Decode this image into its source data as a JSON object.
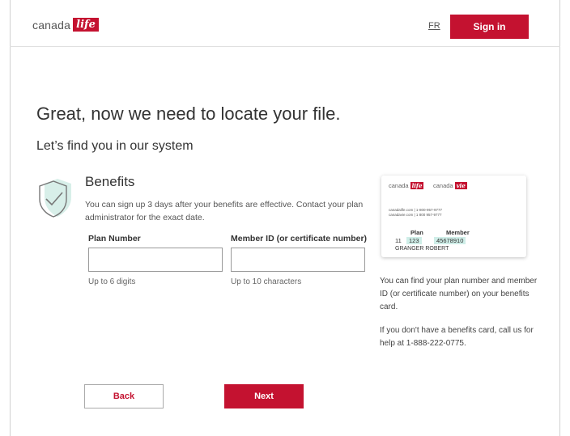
{
  "header": {
    "logo_word": "canada",
    "logo_box": "life",
    "lang_link": "FR",
    "signin_label": "Sign in"
  },
  "main": {
    "title": "Great, now we need to locate your file.",
    "subtitle": "Let’s find you in our system",
    "section_title": "Benefits",
    "section_desc": "You can sign up 3 days after your benefits are effective. Contact your plan administrator for the exact date.",
    "plan_label": "Plan Number",
    "plan_value": "",
    "plan_hint": "Up to 6 digits",
    "member_label": "Member ID (or certificate number)",
    "member_value": "",
    "member_hint": "Up to 10 characters"
  },
  "card": {
    "brand1_word": "canada",
    "brand1_box": "life",
    "brand2_word": "canada",
    "brand2_box": "vie",
    "line1": "canadalife.com | 1-800-957-9777",
    "line2": "canadavie.com | 1 800 957-9777",
    "plan_head": "Plan",
    "member_head": "Member",
    "plan_prefix": "11",
    "plan_number": "123",
    "member_number": "45678910",
    "member_name": "GRANGER ROBERT"
  },
  "help": {
    "find_text": "You can find your plan number and member ID (or certificate number) on your benefits card.",
    "call_text": "If you don't have a benefits card, call us for help at 1-888-222-0775."
  },
  "actions": {
    "back_label": "Back",
    "next_label": "Next"
  },
  "colors": {
    "brand_red": "#c41230",
    "highlight": "#cfeee8"
  }
}
